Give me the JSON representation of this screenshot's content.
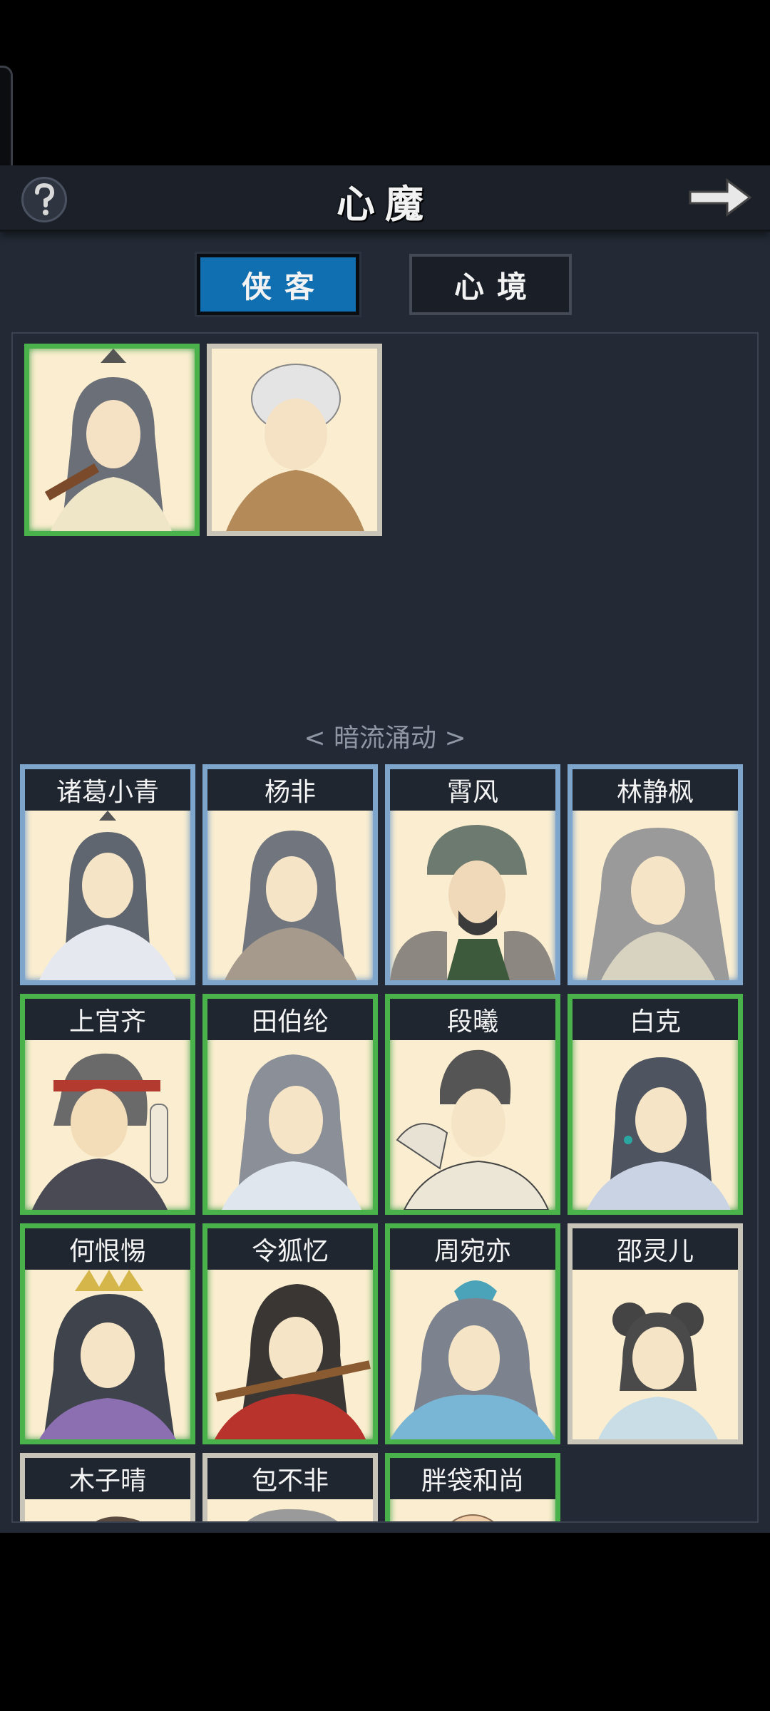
{
  "header": {
    "title": "心魔"
  },
  "tabs": [
    {
      "label": "侠客",
      "active": true
    },
    {
      "label": "心境",
      "active": false
    }
  ],
  "section": {
    "title": "< 暗流涌动 >"
  },
  "characters": [
    {
      "name": "诸葛小青",
      "frame": "blue"
    },
    {
      "name": "杨非",
      "frame": "blue"
    },
    {
      "name": "霄风",
      "frame": "blue"
    },
    {
      "name": "林静枫",
      "frame": "blue"
    },
    {
      "name": "上官齐",
      "frame": "green"
    },
    {
      "name": "田伯纶",
      "frame": "green"
    },
    {
      "name": "段曦",
      "frame": "green"
    },
    {
      "name": "白克",
      "frame": "green"
    },
    {
      "name": "何恨惕",
      "frame": "green"
    },
    {
      "name": "令狐忆",
      "frame": "green"
    },
    {
      "name": "周宛亦",
      "frame": "green"
    },
    {
      "name": "邵灵儿",
      "frame": "plain"
    },
    {
      "name": "木子晴",
      "frame": "plain"
    },
    {
      "name": "包不非",
      "frame": "plain"
    },
    {
      "name": "胖袋和尚",
      "frame": "green"
    }
  ],
  "colors": {
    "accent": "#0f6fb0",
    "panel": "#232a35",
    "card_bg": "#fbeed0"
  },
  "icons": {
    "help": "question-mark",
    "back": "arrow-right"
  }
}
